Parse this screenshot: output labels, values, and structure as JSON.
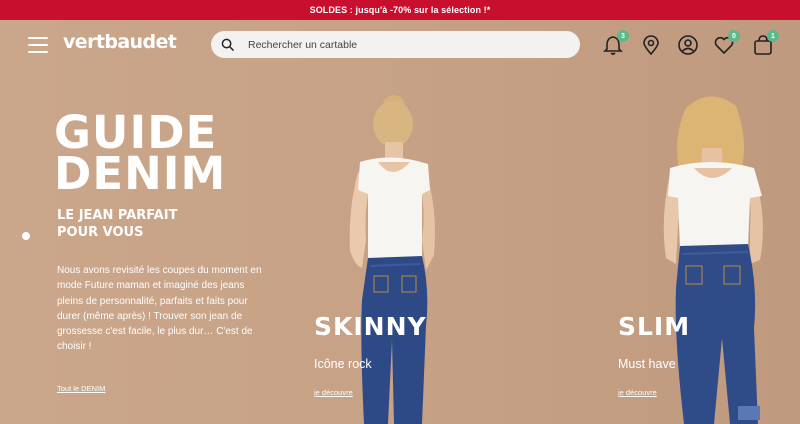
{
  "promo": {
    "text": "SOLDES : jusqu'à -70% sur la sélection !*"
  },
  "header": {
    "logo": "vertbaudet",
    "search_placeholder": "Rechercher un cartable",
    "notifications_count": "3",
    "wishlist_count": "0",
    "cart_count": "1"
  },
  "hero": {
    "title_line1": "GUIDE",
    "title_line2": "DENIM",
    "subtitle_line1": "LE JEAN PARFAIT",
    "subtitle_line2": "POUR VOUS",
    "description": "Nous avons revisité les coupes du moment en mode Future maman et imaginé des jeans pleins de personnalité, parfaits et faits pour durer (même après) ! Trouver son jean de grossesse c'est facile, le plus dur… C'est de choisir !",
    "link": "Tout le DENIM"
  },
  "categories": [
    {
      "title": "SKINNY",
      "subtitle": "Icône rock",
      "link": "je découvre"
    },
    {
      "title": "SLIM",
      "subtitle": "Must have",
      "link": "je découvre"
    }
  ],
  "colors": {
    "promo": "#c8102e",
    "badge": "#5bb98c",
    "denim": "#2e4a86"
  }
}
